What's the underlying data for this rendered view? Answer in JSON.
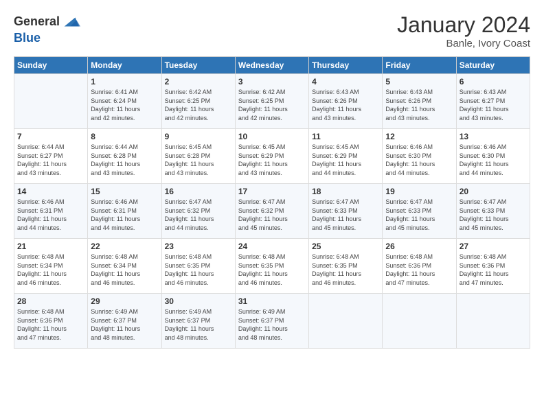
{
  "header": {
    "logo_general": "General",
    "logo_blue": "Blue",
    "title": "January 2024",
    "subtitle": "Banle, Ivory Coast"
  },
  "columns": [
    "Sunday",
    "Monday",
    "Tuesday",
    "Wednesday",
    "Thursday",
    "Friday",
    "Saturday"
  ],
  "rows": [
    [
      {
        "day": "",
        "info": ""
      },
      {
        "day": "1",
        "info": "Sunrise: 6:41 AM\nSunset: 6:24 PM\nDaylight: 11 hours\nand 42 minutes."
      },
      {
        "day": "2",
        "info": "Sunrise: 6:42 AM\nSunset: 6:25 PM\nDaylight: 11 hours\nand 42 minutes."
      },
      {
        "day": "3",
        "info": "Sunrise: 6:42 AM\nSunset: 6:25 PM\nDaylight: 11 hours\nand 42 minutes."
      },
      {
        "day": "4",
        "info": "Sunrise: 6:43 AM\nSunset: 6:26 PM\nDaylight: 11 hours\nand 43 minutes."
      },
      {
        "day": "5",
        "info": "Sunrise: 6:43 AM\nSunset: 6:26 PM\nDaylight: 11 hours\nand 43 minutes."
      },
      {
        "day": "6",
        "info": "Sunrise: 6:43 AM\nSunset: 6:27 PM\nDaylight: 11 hours\nand 43 minutes."
      }
    ],
    [
      {
        "day": "7",
        "info": "Sunrise: 6:44 AM\nSunset: 6:27 PM\nDaylight: 11 hours\nand 43 minutes."
      },
      {
        "day": "8",
        "info": "Sunrise: 6:44 AM\nSunset: 6:28 PM\nDaylight: 11 hours\nand 43 minutes."
      },
      {
        "day": "9",
        "info": "Sunrise: 6:45 AM\nSunset: 6:28 PM\nDaylight: 11 hours\nand 43 minutes."
      },
      {
        "day": "10",
        "info": "Sunrise: 6:45 AM\nSunset: 6:29 PM\nDaylight: 11 hours\nand 43 minutes."
      },
      {
        "day": "11",
        "info": "Sunrise: 6:45 AM\nSunset: 6:29 PM\nDaylight: 11 hours\nand 44 minutes."
      },
      {
        "day": "12",
        "info": "Sunrise: 6:46 AM\nSunset: 6:30 PM\nDaylight: 11 hours\nand 44 minutes."
      },
      {
        "day": "13",
        "info": "Sunrise: 6:46 AM\nSunset: 6:30 PM\nDaylight: 11 hours\nand 44 minutes."
      }
    ],
    [
      {
        "day": "14",
        "info": "Sunrise: 6:46 AM\nSunset: 6:31 PM\nDaylight: 11 hours\nand 44 minutes."
      },
      {
        "day": "15",
        "info": "Sunrise: 6:46 AM\nSunset: 6:31 PM\nDaylight: 11 hours\nand 44 minutes."
      },
      {
        "day": "16",
        "info": "Sunrise: 6:47 AM\nSunset: 6:32 PM\nDaylight: 11 hours\nand 44 minutes."
      },
      {
        "day": "17",
        "info": "Sunrise: 6:47 AM\nSunset: 6:32 PM\nDaylight: 11 hours\nand 45 minutes."
      },
      {
        "day": "18",
        "info": "Sunrise: 6:47 AM\nSunset: 6:33 PM\nDaylight: 11 hours\nand 45 minutes."
      },
      {
        "day": "19",
        "info": "Sunrise: 6:47 AM\nSunset: 6:33 PM\nDaylight: 11 hours\nand 45 minutes."
      },
      {
        "day": "20",
        "info": "Sunrise: 6:47 AM\nSunset: 6:33 PM\nDaylight: 11 hours\nand 45 minutes."
      }
    ],
    [
      {
        "day": "21",
        "info": "Sunrise: 6:48 AM\nSunset: 6:34 PM\nDaylight: 11 hours\nand 46 minutes."
      },
      {
        "day": "22",
        "info": "Sunrise: 6:48 AM\nSunset: 6:34 PM\nDaylight: 11 hours\nand 46 minutes."
      },
      {
        "day": "23",
        "info": "Sunrise: 6:48 AM\nSunset: 6:35 PM\nDaylight: 11 hours\nand 46 minutes."
      },
      {
        "day": "24",
        "info": "Sunrise: 6:48 AM\nSunset: 6:35 PM\nDaylight: 11 hours\nand 46 minutes."
      },
      {
        "day": "25",
        "info": "Sunrise: 6:48 AM\nSunset: 6:35 PM\nDaylight: 11 hours\nand 46 minutes."
      },
      {
        "day": "26",
        "info": "Sunrise: 6:48 AM\nSunset: 6:36 PM\nDaylight: 11 hours\nand 47 minutes."
      },
      {
        "day": "27",
        "info": "Sunrise: 6:48 AM\nSunset: 6:36 PM\nDaylight: 11 hours\nand 47 minutes."
      }
    ],
    [
      {
        "day": "28",
        "info": "Sunrise: 6:48 AM\nSunset: 6:36 PM\nDaylight: 11 hours\nand 47 minutes."
      },
      {
        "day": "29",
        "info": "Sunrise: 6:49 AM\nSunset: 6:37 PM\nDaylight: 11 hours\nand 48 minutes."
      },
      {
        "day": "30",
        "info": "Sunrise: 6:49 AM\nSunset: 6:37 PM\nDaylight: 11 hours\nand 48 minutes."
      },
      {
        "day": "31",
        "info": "Sunrise: 6:49 AM\nSunset: 6:37 PM\nDaylight: 11 hours\nand 48 minutes."
      },
      {
        "day": "",
        "info": ""
      },
      {
        "day": "",
        "info": ""
      },
      {
        "day": "",
        "info": ""
      }
    ]
  ]
}
